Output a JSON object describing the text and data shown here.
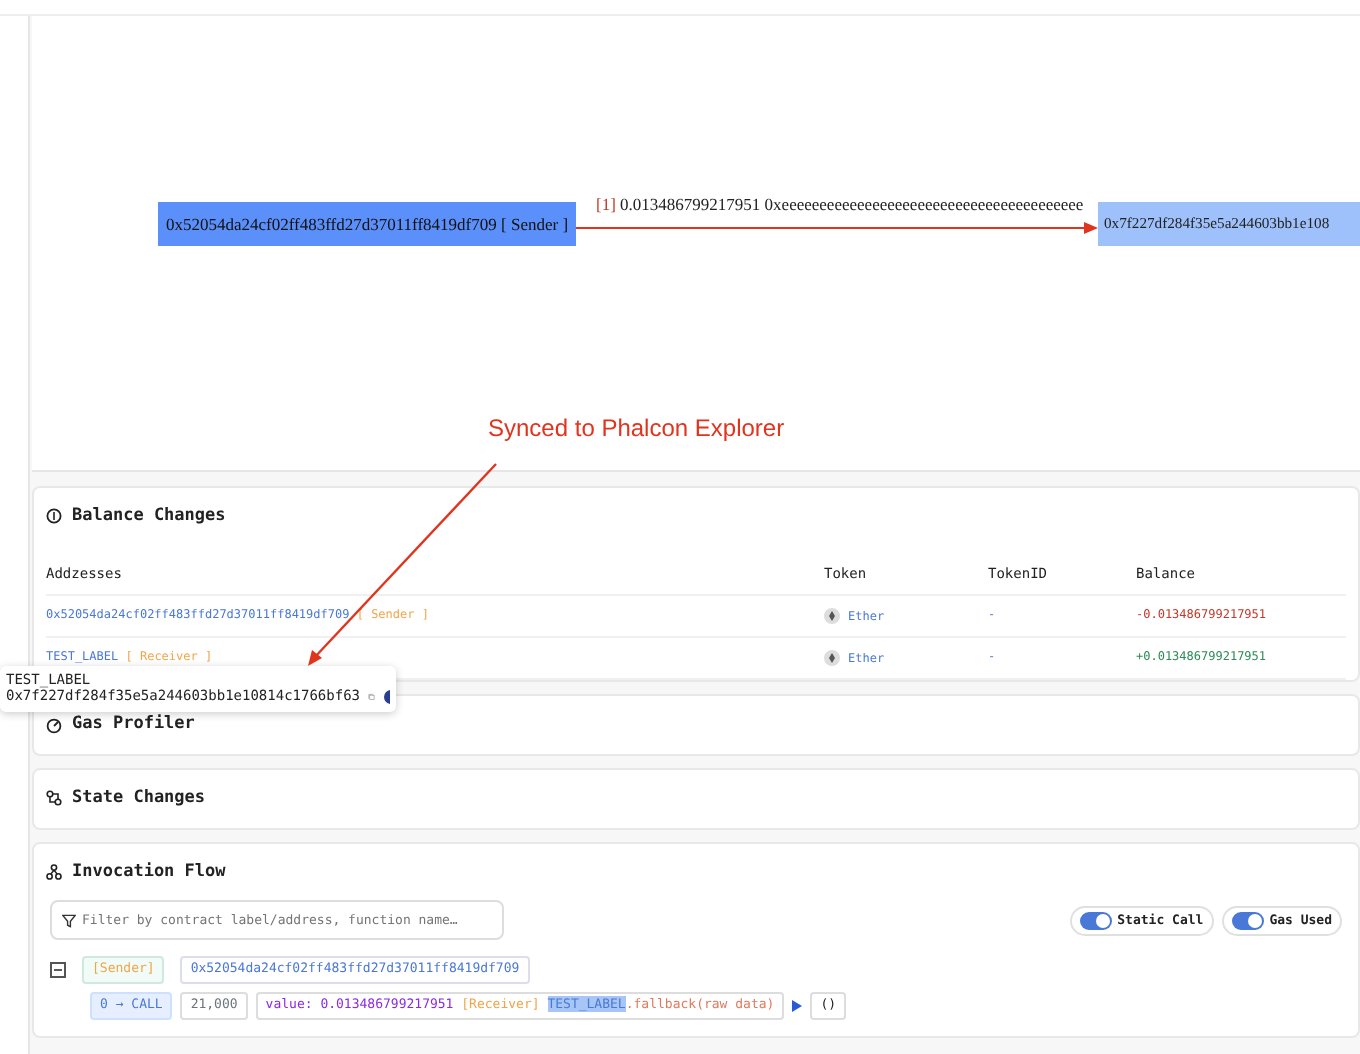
{
  "diagram": {
    "sender": "0x52054da24cf02ff483ffd27d37011ff8419df709 [ Sender ]",
    "edge_index": "[1]",
    "edge_label": "0.013486799217951 0xeeeeeeeeeeeeeeeeeeeeeeeeeeeeeeeeeeeeeeee",
    "receiver": "0x7f227df284f35e5a244603bb1e108"
  },
  "annotation": "Synced to Phalcon Explorer",
  "balance_changes": {
    "title": "Balance Changes",
    "columns": [
      "Addzesses",
      "Token",
      "TokenID",
      "Balance"
    ],
    "rows": [
      {
        "address": "0x52054da24cf02ff483ffd27d37011ff8419df709",
        "role": "[ Sender ]",
        "token": "Ether",
        "token_id": "-",
        "balance": "-0.013486799217951",
        "color": "#c0392b"
      },
      {
        "address": "TEST_LABEL",
        "role": "[ Receiver ]",
        "token": "Ether",
        "token_id": "-",
        "balance": "+0.013486799217951",
        "color": "#2e8b57"
      }
    ]
  },
  "tooltip": {
    "label": "TEST_LABEL",
    "address": "0x7f227df284f35e5a244603bb1e10814c1766bf63"
  },
  "sections": [
    "Gas Profiler",
    "State Changes"
  ],
  "invocation_flow": {
    "title": "Invocation Flow",
    "filter": {
      "placeholder": "Filter by contract label/address, function name…"
    },
    "toggles": [
      {
        "label": "Static Call",
        "on": true
      },
      {
        "label": "Gas Used",
        "on": true
      }
    ],
    "root": {
      "role": "[Sender]",
      "address": "0x52054da24cf02ff483ffd27d37011ff8419df709",
      "expanded": true
    },
    "call": {
      "step": "0 → CALL",
      "gas": "21,000",
      "value_prefix": "value: 0.013486799217951",
      "role": "[Receiver]",
      "target": "TEST_LABEL",
      "method": ".fallback(raw data)",
      "result": "()"
    }
  }
}
